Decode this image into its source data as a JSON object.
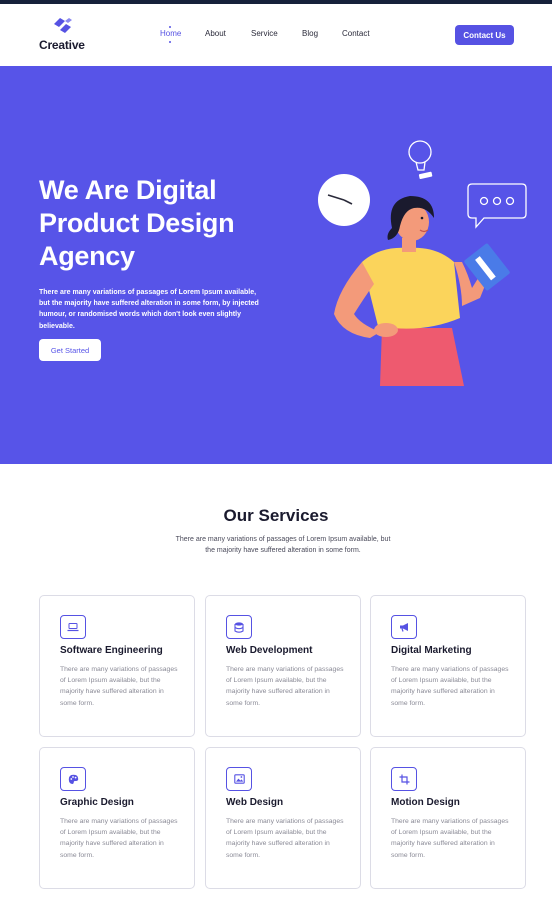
{
  "colors": {
    "primary": "#5652e3",
    "hero_bg": "#5754e8",
    "topbar": "#16213a"
  },
  "brand": {
    "name": "Creative",
    "logo_icon": "chevron-stack-icon"
  },
  "nav": {
    "items": [
      {
        "label": "Home",
        "active": true
      },
      {
        "label": "About",
        "active": false
      },
      {
        "label": "Service",
        "active": false
      },
      {
        "label": "Blog",
        "active": false
      },
      {
        "label": "Contact",
        "active": false
      }
    ],
    "cta": "Contact Us"
  },
  "hero": {
    "title": "We Are Digital Product Design Agency",
    "text": "There are many variations of passages of Lorem Ipsum available, but the majority have suffered alteration in some form, by injected humour, or randomised words which don't look even slightly believable.",
    "button": "Get Started"
  },
  "services": {
    "title": "Our Services",
    "subtitle": "There are many variations of passages of Lorem Ipsum available, but the majority have suffered alteration in some form.",
    "cards": [
      {
        "title": "Software Engineering",
        "icon": "laptop-icon",
        "text": "There are many variations of passages of Lorem Ipsum available, but the majority have suffered alteration in some form."
      },
      {
        "title": "Web Development",
        "icon": "database-icon",
        "text": "There are many variations of passages of Lorem Ipsum available, but the majority have suffered alteration in some form."
      },
      {
        "title": "Digital Marketing",
        "icon": "megaphone-icon",
        "text": "There are many variations of passages of Lorem Ipsum available, but the majority have suffered alteration in some form."
      },
      {
        "title": "Graphic Design",
        "icon": "palette-icon",
        "text": "There are many variations of passages of Lorem Ipsum available, but the majority have suffered alteration in some form."
      },
      {
        "title": "Web Design",
        "icon": "image-icon",
        "text": "There are many variations of passages of Lorem Ipsum available, but the majority have suffered alteration in some form."
      },
      {
        "title": "Motion Design",
        "icon": "crop-icon",
        "text": "There are many variations of passages of Lorem Ipsum available, but the majority have suffered alteration in some form."
      }
    ]
  }
}
